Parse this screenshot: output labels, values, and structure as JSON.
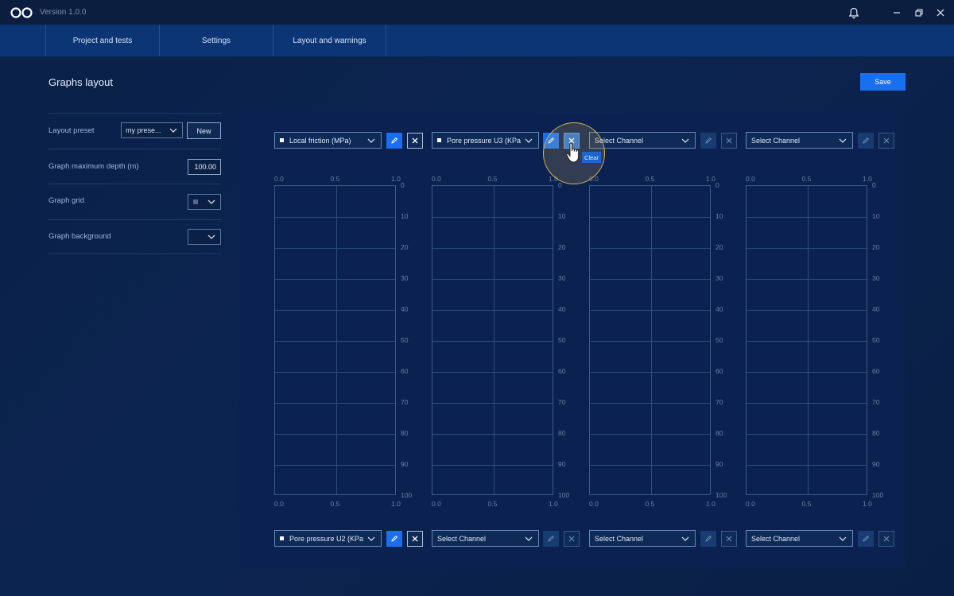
{
  "app": {
    "version": "Version 1.0.0",
    "colors": {
      "accent": "#1a6ff0",
      "tabbar": "#0c3576",
      "highlight": "#d7b45a"
    }
  },
  "tabs": [
    {
      "label": "Project and tests"
    },
    {
      "label": "Settings"
    },
    {
      "label": "Layout and warnings"
    }
  ],
  "page": {
    "title": "Graphs layout",
    "save_label": "Save"
  },
  "settings": {
    "layout_preset": {
      "label": "Layout preset",
      "value": "my prese...",
      "new_label": "New"
    },
    "max_depth": {
      "label": "Graph maximum depth (m)",
      "value": "100.00"
    },
    "grid": {
      "label": "Graph grid"
    },
    "background": {
      "label": "Graph background"
    }
  },
  "channels_top": [
    {
      "label": "Local friction (MPa)",
      "has_dot": true
    },
    {
      "label": "Pore pressure U3 (KPa",
      "has_dot": true
    },
    {
      "label": "Select Channel",
      "has_dot": false
    },
    {
      "label": "Select Channel",
      "has_dot": false
    }
  ],
  "channels_bottom": [
    {
      "label": "Pore pressure U2 (KPa",
      "has_dot": true
    },
    {
      "label": "Select Channel",
      "has_dot": false
    },
    {
      "label": "Select Channel",
      "has_dot": false
    },
    {
      "label": "Select Channel",
      "has_dot": false
    }
  ],
  "axes": {
    "x_ticks": [
      "0.0",
      "0.5",
      "1.0"
    ],
    "depth_ticks": [
      "0",
      "10",
      "20",
      "30",
      "40",
      "50",
      "60",
      "70",
      "80",
      "90",
      "100"
    ]
  },
  "tooltip": {
    "clear": "Clear"
  },
  "icons": [
    "infinity-logo-icon",
    "bell-icon",
    "minimize-icon",
    "restore-icon",
    "close-icon",
    "chevron-down-icon",
    "pencil-icon",
    "x-icon",
    "hand-pointer-icon"
  ]
}
